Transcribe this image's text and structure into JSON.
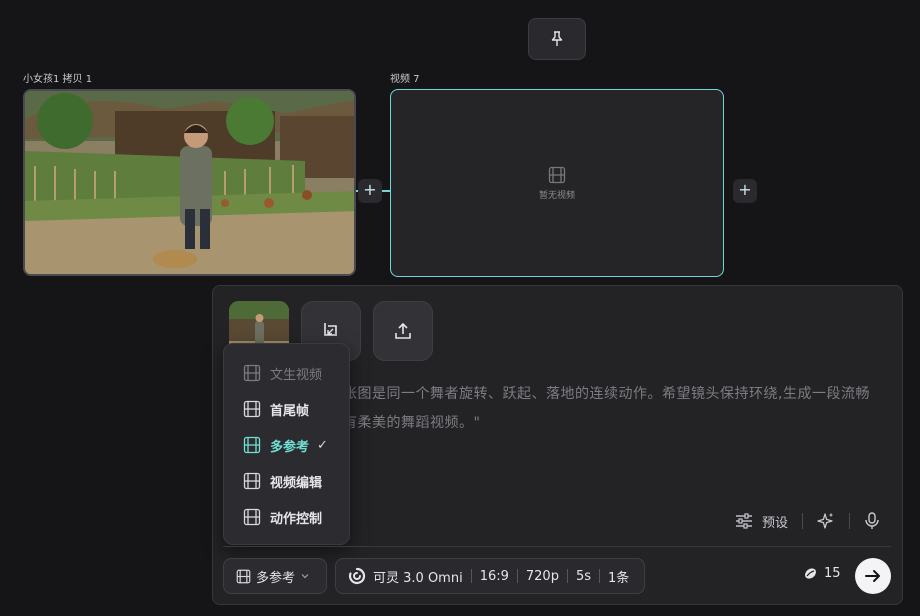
{
  "canvas": {
    "image_node": {
      "label": "小女孩1 拷贝 1"
    },
    "video_node": {
      "label": "视频 7",
      "empty_text": "暂无视频"
    }
  },
  "prompt": {
    "line1": "张图是同一个舞者旋转、跃起、落地的连续动作。希望镜头保持环绕,生成一段流畅",
    "line2": "有柔美的舞蹈视频。\""
  },
  "mode_menu": {
    "items": [
      {
        "label": "文生视频",
        "state": "disabled"
      },
      {
        "label": "首尾帧",
        "state": "normal"
      },
      {
        "label": "多参考",
        "state": "active",
        "check": "✓"
      },
      {
        "label": "视频编辑",
        "state": "normal"
      },
      {
        "label": "动作控制",
        "state": "normal"
      }
    ]
  },
  "toolbar": {
    "preset_label": "预设",
    "mode_label": "多参考",
    "model": "可灵 3.0 Omni",
    "ratio": "16:9",
    "resolution": "720p",
    "duration": "5s",
    "count": "1条",
    "credits": "15"
  },
  "colors": {
    "accent": "#6fd6de",
    "active": "#6fe0d4"
  }
}
